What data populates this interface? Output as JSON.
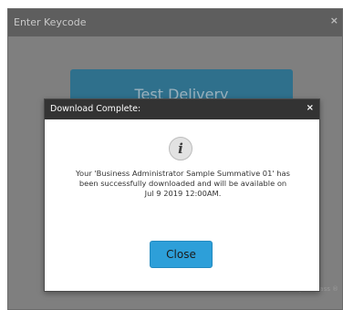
{
  "outer_window": {
    "title": "Enter Keycode",
    "close_glyph": "×",
    "primary_button_label": "Test Delivery",
    "powered_by": "Powered by Surpass",
    "registered_mark": "®"
  },
  "dialog": {
    "title": "Download Complete:",
    "close_glyph": "×",
    "info_icon_glyph": "i",
    "message_lines": [
      "Your 'Business Administrator Sample Summative 01' has",
      "been successfully downloaded and will be available on",
      "Jul  9 2019 12:00AM."
    ],
    "close_button_label": "Close"
  },
  "colors": {
    "dialog_header": "#333333",
    "close_button": "#2d9fd9",
    "overlay": "#7f7f7f",
    "test_delivery_button": "#2f708c"
  },
  "icons": [
    "close-icon",
    "info-icon"
  ]
}
